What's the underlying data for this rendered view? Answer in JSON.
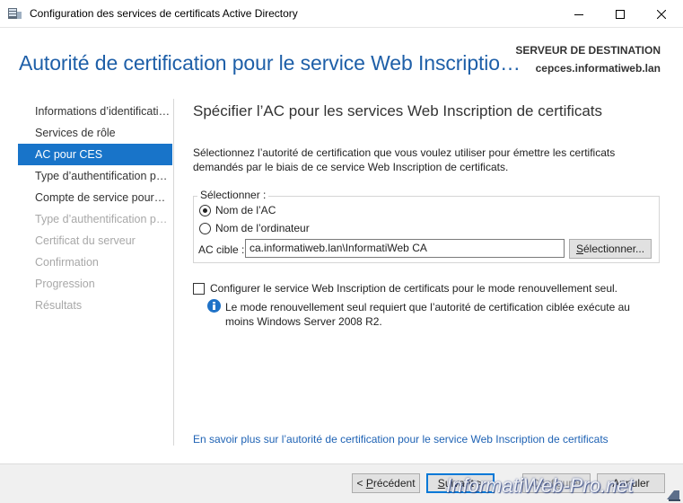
{
  "window": {
    "title": "Configuration des services de certificats Active Directory"
  },
  "header": {
    "title": "Autorité de certification pour le service Web Inscriptio…",
    "destination_label": "SERVEUR DE DESTINATION",
    "destination_server": "cepces.informatiweb.lan"
  },
  "nav": {
    "items": [
      {
        "label": "Informations d’identificati…",
        "state": "normal"
      },
      {
        "label": "Services de rôle",
        "state": "normal"
      },
      {
        "label": "AC pour CES",
        "state": "active"
      },
      {
        "label": "Type d’authentification po…",
        "state": "normal"
      },
      {
        "label": "Compte de service pour…",
        "state": "normal"
      },
      {
        "label": "Type d’authentification po…",
        "state": "disabled"
      },
      {
        "label": "Certificat du serveur",
        "state": "disabled"
      },
      {
        "label": "Confirmation",
        "state": "disabled"
      },
      {
        "label": "Progression",
        "state": "disabled"
      },
      {
        "label": "Résultats",
        "state": "disabled"
      }
    ]
  },
  "content": {
    "title": "Spécifier l’AC pour les services Web Inscription de certificats",
    "description": "Sélectionnez l’autorité de certification que vous voulez utiliser pour émettre les certificats demandés par le biais de ce service Web Inscription de certificats.",
    "group_label": "Sélectionner :",
    "radio_ca_name": "Nom de l’AC",
    "radio_computer_name": "Nom de l’ordinateur",
    "selected_radio": "ca_name",
    "target_label": "AC cible :",
    "target_value": "ca.informatiweb.lan\\InformatiWeb CA",
    "select_button": "Sélectionner...",
    "renewal_checkbox_label": "Configurer le service Web Inscription de certificats pour le mode renouvellement seul.",
    "renewal_checked": false,
    "info_text": "Le mode renouvellement seul requiert que l’autorité de certification ciblée exécute au moins Windows Server 2008 R2.",
    "learn_more_link": "En savoir plus sur l’autorité de certification pour le service Web Inscription de certificats"
  },
  "footer": {
    "prev_label": "Précédent",
    "next_label": "Suivant",
    "configure_label": "Configurer",
    "cancel_label": "Annuler"
  },
  "watermark": "InformatiWeb-Pro.net",
  "colors": {
    "accent": "#1874c9",
    "header_title": "#1e5fa8",
    "link": "#1e62b4",
    "disabled": "#a8a8a8"
  }
}
